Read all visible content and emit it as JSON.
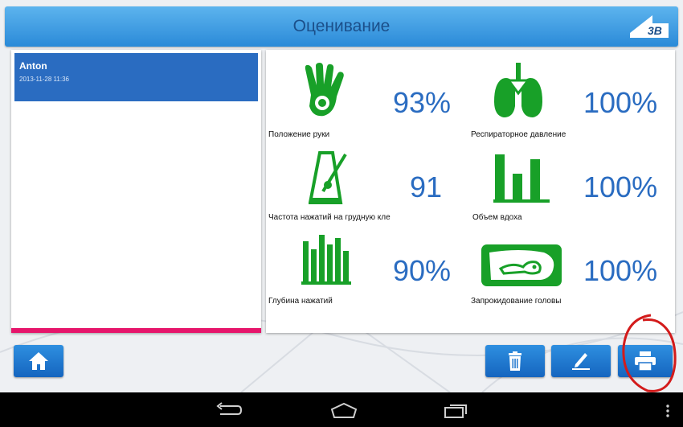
{
  "header": {
    "title": "Оценивание",
    "logo_text": "3B"
  },
  "sessions": [
    {
      "name": "Anton",
      "date": "2013-11-28 11:36"
    }
  ],
  "results": [
    {
      "label": "Положение руки",
      "value": "93%",
      "icon": "hand-icon"
    },
    {
      "label": "Респираторное давление",
      "value": "100%",
      "icon": "lungs-icon"
    },
    {
      "label": "Частота нажатий на грудную кле",
      "value": "91",
      "icon": "metronome-icon"
    },
    {
      "label": "Объем вдоха",
      "value": "100%",
      "icon": "volume-bars-icon"
    },
    {
      "label": "Глубина нажатий",
      "value": "90%",
      "icon": "depth-bars-icon"
    },
    {
      "label": "Запрокидование головы",
      "value": "100%",
      "icon": "head-tilt-icon"
    }
  ],
  "toolbar": {
    "home_icon": "home-icon",
    "delete_icon": "trash-icon",
    "edit_icon": "pen-icon",
    "print_icon": "printer-icon"
  },
  "colors": {
    "accent": "#2a6cc1",
    "icon_green": "#18a028",
    "highlight_bar": "#e6156b",
    "annotation": "#d31b1b"
  }
}
